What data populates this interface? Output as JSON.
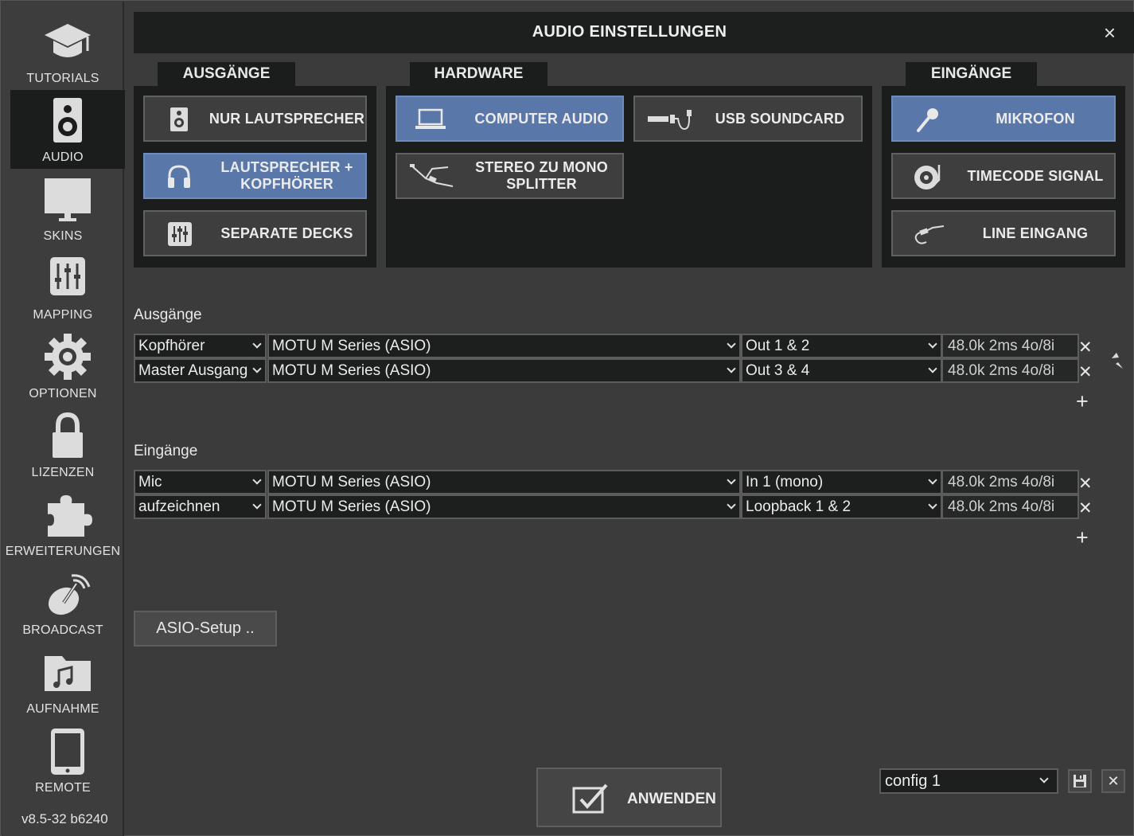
{
  "sidebar": {
    "items": [
      {
        "label": "TUTORIALS",
        "icon": "graduation-cap-icon"
      },
      {
        "label": "AUDIO",
        "icon": "speaker-icon",
        "active": true
      },
      {
        "label": "SKINS",
        "icon": "monitor-icon"
      },
      {
        "label": "MAPPING",
        "icon": "sliders-icon"
      },
      {
        "label": "OPTIONEN",
        "icon": "gear-icon"
      },
      {
        "label": "LIZENZEN",
        "icon": "lock-icon"
      },
      {
        "label": "ERWEITERUNGEN",
        "icon": "puzzle-icon"
      },
      {
        "label": "BROADCAST",
        "icon": "satellite-dish-icon"
      },
      {
        "label": "AUFNAHME",
        "icon": "music-folder-icon"
      },
      {
        "label": "REMOTE",
        "icon": "tablet-icon"
      }
    ],
    "version": "v8.5-32 b6240"
  },
  "dialog": {
    "title": "AUDIO EINSTELLUNGEN",
    "close": "×"
  },
  "outputs_panel": {
    "tab": "AUSGÄNGE",
    "buttons": [
      {
        "label": "NUR LAUTSPRECHER",
        "icon": "speaker-icon",
        "selected": false
      },
      {
        "label": "LAUTSPRECHER + KOPFHÖRER",
        "icon": "headphones-icon",
        "selected": true
      },
      {
        "label": "SEPARATE DECKS",
        "icon": "mixer-icon",
        "selected": false
      }
    ]
  },
  "hardware_panel": {
    "tab": "HARDWARE",
    "buttons": [
      {
        "label": "COMPUTER AUDIO",
        "icon": "laptop-icon",
        "selected": true
      },
      {
        "label": "USB SOUNDCARD",
        "icon": "usb-cable-icon",
        "selected": false
      },
      {
        "label": "STEREO ZU MONO SPLITTER",
        "icon": "splitter-cable-icon",
        "selected": false
      }
    ]
  },
  "inputs_panel": {
    "tab": "EINGÄNGE",
    "buttons": [
      {
        "label": "MIKROFON",
        "icon": "microphone-icon",
        "selected": true
      },
      {
        "label": "TIMECODE SIGNAL",
        "icon": "turntable-icon",
        "selected": false
      },
      {
        "label": "LINE EINGANG",
        "icon": "line-cable-icon",
        "selected": false
      }
    ]
  },
  "outputs_table": {
    "label": "Ausgänge",
    "rows": [
      {
        "role": "Kopfhörer",
        "device": "MOTU M Series (ASIO)",
        "channels": "Out 1 & 2",
        "info": "48.0k 2ms 4o/8i"
      },
      {
        "role": "Master Ausgang",
        "device": "MOTU M Series (ASIO)",
        "channels": "Out 3 & 4",
        "info": "48.0k 2ms 4o/8i"
      }
    ]
  },
  "inputs_table": {
    "label": "Eingänge",
    "rows": [
      {
        "role": "Mic",
        "device": "MOTU M Series (ASIO)",
        "channels": "In 1 (mono)",
        "info": "48.0k 2ms 4o/8i"
      },
      {
        "role": "aufzeichnen",
        "device": "MOTU M Series (ASIO)",
        "channels": "Loopback 1 & 2",
        "info": "48.0k 2ms 4o/8i"
      }
    ]
  },
  "asio_setup": "ASIO-Setup ..",
  "apply": "ANWENDEN",
  "config": {
    "value": "config 1"
  },
  "glyphs": {
    "row_remove": "✕",
    "add": "+",
    "config_delete": "✕"
  },
  "colors": {
    "selected_button": "#5a77aa",
    "panel_bg": "#1b1d1d",
    "window_bg": "#3b3b3b"
  }
}
